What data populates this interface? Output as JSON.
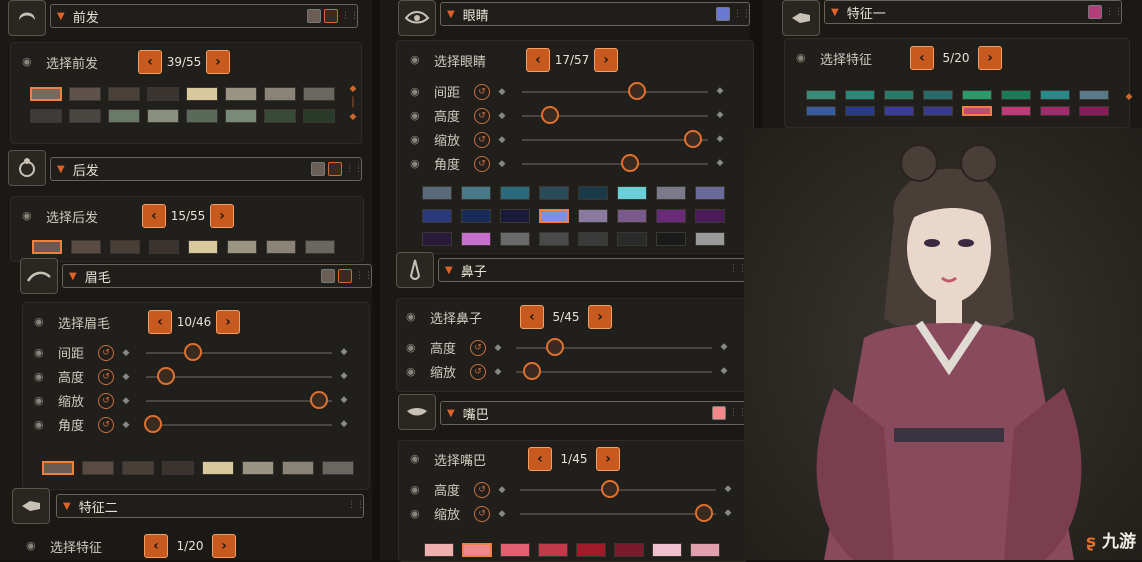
{
  "col1": {
    "front_hair": {
      "title": "前发",
      "select_label": "选择前发",
      "counter": "39/55",
      "colors": [
        "#7a6a5e",
        "#5e524a",
        "#4a403a",
        "#3a3430",
        "#d8c89c",
        "#9a9482",
        "#8a8478",
        "#6a6660",
        "#3e3c38",
        "#4a4642",
        "#6a7a6a",
        "#8a9080",
        "#5a6a5a",
        "#7a8a7a",
        "#3a4a3a",
        "#2a3a2a"
      ]
    },
    "back_hair": {
      "title": "后发",
      "select_label": "选择后发",
      "counter": "15/55",
      "colors": [
        "#6a5a50",
        "#5a4c44",
        "#4a3e38",
        "#3a332e",
        "#d8c89c",
        "#9a9482",
        "#8a8478",
        "#6a6660"
      ]
    },
    "eyebrow": {
      "title": "眉毛",
      "select_label": "选择眉毛",
      "counter": "10/46",
      "sliders": [
        {
          "label": "间距",
          "value": 0.25
        },
        {
          "label": "高度",
          "value": 0.11
        },
        {
          "label": "缩放",
          "value": 0.93
        },
        {
          "label": "角度",
          "value": 0.04
        }
      ],
      "colors": [
        "#6a5a50",
        "#5a4c44",
        "#4a3e38",
        "#3a332e",
        "#d8c89c",
        "#9a9482",
        "#8a8478",
        "#6a6660"
      ]
    },
    "feature_two": {
      "title": "特征二",
      "select_label": "选择特征",
      "counter": "1/20"
    }
  },
  "col2": {
    "eyes": {
      "title": "眼睛",
      "select_label": "选择眼睛",
      "counter": "17/57",
      "accent": "#6a7ad0",
      "sliders": [
        {
          "label": "间距",
          "value": 0.62
        },
        {
          "label": "高度",
          "value": 0.15
        },
        {
          "label": "缩放",
          "value": 0.92
        },
        {
          "label": "角度",
          "value": 0.58
        }
      ],
      "colors": [
        "#5a6a7a",
        "#4a7a8a",
        "#2a6a7a",
        "#2a4a5a",
        "#1a3a4a",
        "#6ad0d8",
        "#7a7a8a",
        "#6a6a9a",
        "#2a3a7a",
        "#1a2a5a",
        "#1a1a3a",
        "#7a90e0",
        "#8a7aa0",
        "#7a5a8a",
        "#6a2a7a",
        "#4a1a5a",
        "#2a1a3a",
        "#c870d0",
        "#6a6a6a",
        "#4a4a4a",
        "#3a3a3a",
        "#2a2a2a",
        "#1a1a1a",
        "#9a9a9a"
      ]
    },
    "nose": {
      "title": "鼻子",
      "select_label": "选择鼻子",
      "counter": "5/45",
      "sliders": [
        {
          "label": "高度",
          "value": 0.2
        },
        {
          "label": "缩放",
          "value": 0.08
        }
      ]
    },
    "mouth": {
      "title": "嘴巴",
      "select_label": "选择嘴巴",
      "counter": "1/45",
      "accent": "#f08a8a",
      "sliders": [
        {
          "label": "高度",
          "value": 0.46
        },
        {
          "label": "缩放",
          "value": 0.94
        }
      ],
      "colors": [
        "#f0b0b0",
        "#f08a8a",
        "#e06070",
        "#c03a4a",
        "#a01a2a",
        "#7a1a2a",
        "#f0c0d0",
        "#e0a0b0"
      ]
    }
  },
  "col3": {
    "feature_one": {
      "title": "特征一",
      "select_label": "选择特征",
      "counter": "5/20",
      "accent": "#b0407a",
      "colors": [
        "#3a8a7a",
        "#2a8a7a",
        "#2a7a6a",
        "#2a6a6a",
        "#2a9a6a",
        "#1a7a5a",
        "#2a8a8a",
        "#5a7a8a",
        "#3a5a9a",
        "#2a3a8a",
        "#3a3aa0",
        "#3a3a8a",
        "#c04a7a",
        "#c03a7a",
        "#a02a6a",
        "#8a1a5a"
      ]
    }
  },
  "watermark": "九游"
}
